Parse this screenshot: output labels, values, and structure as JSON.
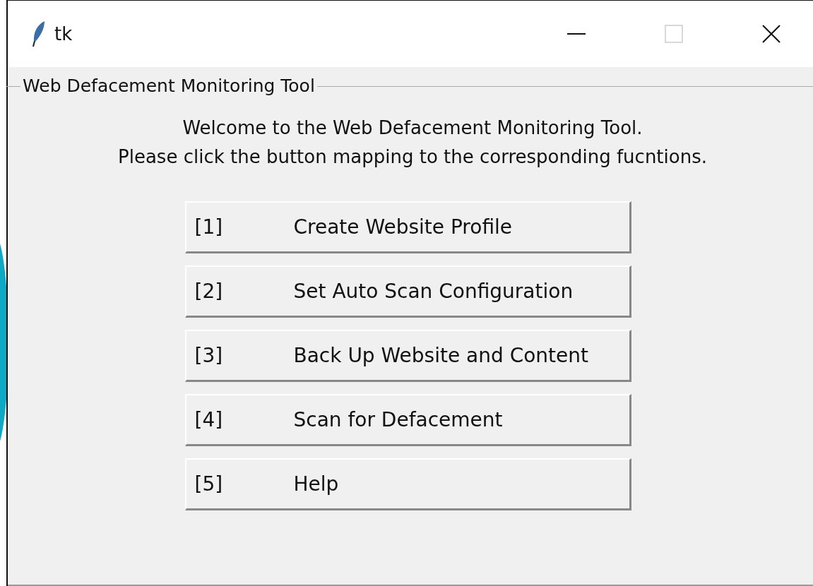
{
  "window": {
    "title": "tk"
  },
  "group": {
    "title": "Web Defacement Monitoring Tool"
  },
  "intro": [
    "Welcome to the Web Defacement Monitoring Tool.",
    "Please click the button mapping to the corresponding fucntions."
  ],
  "buttons": [
    {
      "key": "[1]",
      "label": "Create Website Profile"
    },
    {
      "key": "[2]",
      "label": "Set Auto Scan Configuration"
    },
    {
      "key": "[3]",
      "label": "Back Up Website and Content"
    },
    {
      "key": "[4]",
      "label": "Scan for Defacement"
    },
    {
      "key": "[5]",
      "label": "Help"
    }
  ]
}
